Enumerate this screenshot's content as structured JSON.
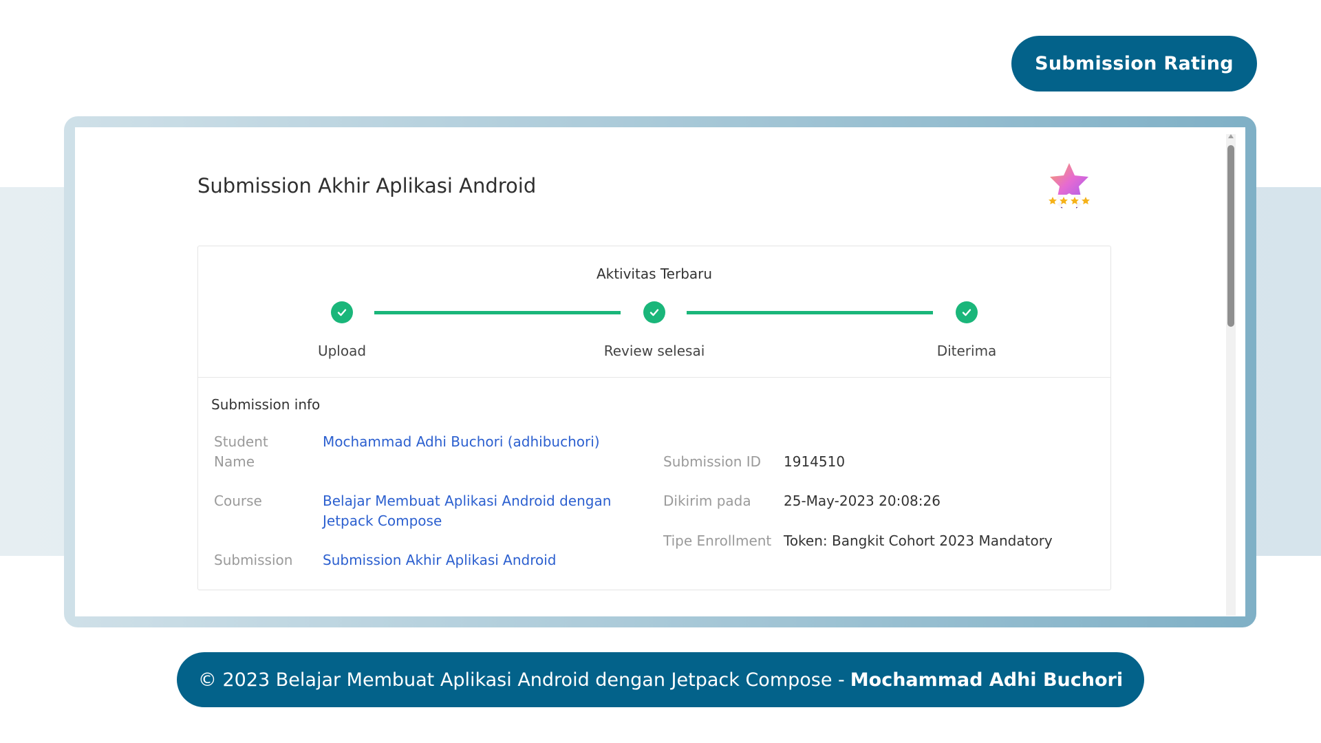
{
  "header": {
    "badge_label": "Submission Rating"
  },
  "page": {
    "title": "Submission Akhir Aplikasi Android"
  },
  "rating": {
    "stars": 4,
    "max_stars": 4
  },
  "progress": {
    "title": "Aktivitas Terbaru",
    "steps": [
      {
        "label": "Upload",
        "status": "done"
      },
      {
        "label": "Review selesai",
        "status": "done"
      },
      {
        "label": "Diterima",
        "status": "done"
      }
    ]
  },
  "info": {
    "section_title": "Submission info",
    "student_name_label": "Student\nName",
    "student_name_value": "Mochammad Adhi Buchori (adhibuchori)",
    "course_label": "Course",
    "course_value": "Belajar Membuat Aplikasi Android dengan Jetpack Compose",
    "submission_label": "Submission",
    "submission_value": "Submission Akhir Aplikasi Android",
    "submission_id_label": "Submission ID",
    "submission_id_value": "1914510",
    "sent_at_label": "Dikirim pada",
    "sent_at_value": "25-May-2023 20:08:26",
    "enrollment_label": "Tipe Enrollment",
    "enrollment_value": "Token: Bangkit Cohort 2023 Mandatory"
  },
  "footer": {
    "text": "© 2023 Belajar Membuat Aplikasi Android dengan Jetpack Compose -",
    "author": "Mochammad Adhi Buchori"
  },
  "colors": {
    "brand": "#03628a",
    "success": "#1ab67a",
    "link": "#2b5fcf"
  }
}
